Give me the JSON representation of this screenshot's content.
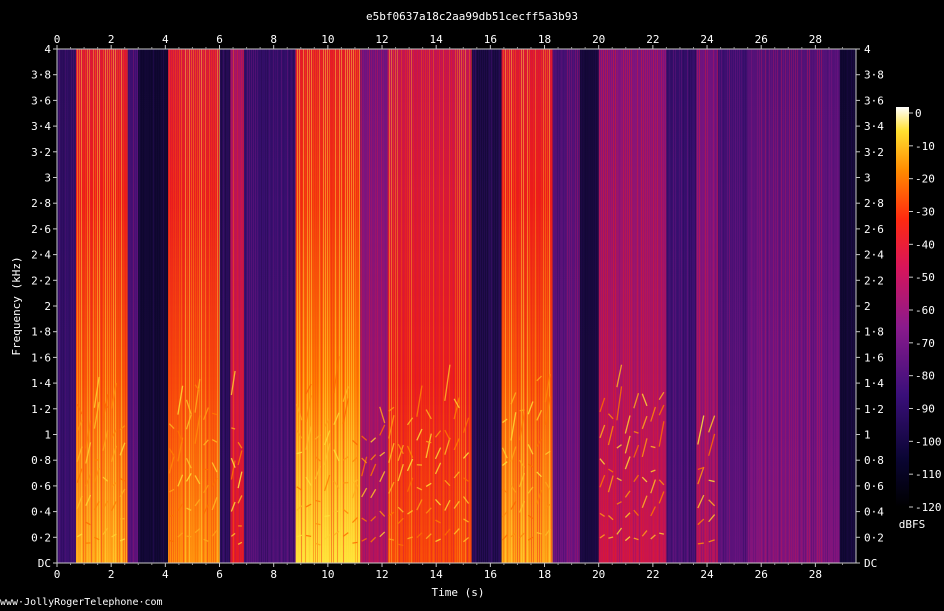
{
  "chart_data": {
    "type": "heatmap",
    "title": "e5bf0637a18c2aa99db51cecff5a3b93",
    "xlabel": "Time (s)",
    "ylabel": "Frequency (kHz)",
    "xlim": [
      0,
      29.5
    ],
    "ylim": [
      0,
      4
    ],
    "x_ticks": [
      "0",
      "2",
      "4",
      "6",
      "8",
      "10",
      "12",
      "14",
      "16",
      "18",
      "20",
      "22",
      "24",
      "26",
      "28"
    ],
    "y_ticks": [
      "DC",
      "0·2",
      "0·4",
      "0·6",
      "0·8",
      "1",
      "1·2",
      "1·4",
      "1·6",
      "1·8",
      "2",
      "2·2",
      "2·4",
      "2·6",
      "2·8",
      "3",
      "3·2",
      "3·4",
      "3·6",
      "3·8",
      "4"
    ],
    "colorbar": {
      "label": "dBFS",
      "range": [
        -120,
        0
      ],
      "ticks": [
        "0",
        "-10",
        "-20",
        "-30",
        "-40",
        "-50",
        "-60",
        "-70",
        "-80",
        "-90",
        "-100",
        "-110",
        "-120"
      ]
    },
    "energy_segments": [
      {
        "start": 0.0,
        "end": 0.7,
        "level": 0.25
      },
      {
        "start": 0.7,
        "end": 2.6,
        "level": 0.9
      },
      {
        "start": 2.6,
        "end": 3.0,
        "level": 0.35
      },
      {
        "start": 3.0,
        "end": 4.1,
        "level": 0.05
      },
      {
        "start": 4.1,
        "end": 6.0,
        "level": 0.88
      },
      {
        "start": 6.0,
        "end": 6.4,
        "level": 0.2
      },
      {
        "start": 6.4,
        "end": 6.9,
        "level": 0.7
      },
      {
        "start": 6.9,
        "end": 8.8,
        "level": 0.3
      },
      {
        "start": 8.8,
        "end": 11.2,
        "level": 0.95
      },
      {
        "start": 11.2,
        "end": 12.2,
        "level": 0.55
      },
      {
        "start": 12.2,
        "end": 15.3,
        "level": 0.8
      },
      {
        "start": 15.3,
        "end": 16.4,
        "level": 0.15
      },
      {
        "start": 16.4,
        "end": 18.3,
        "level": 0.9
      },
      {
        "start": 18.3,
        "end": 19.3,
        "level": 0.4
      },
      {
        "start": 19.3,
        "end": 20.0,
        "level": 0.08
      },
      {
        "start": 20.0,
        "end": 22.5,
        "level": 0.6
      },
      {
        "start": 22.5,
        "end": 23.6,
        "level": 0.3
      },
      {
        "start": 23.6,
        "end": 24.4,
        "level": 0.55
      },
      {
        "start": 24.4,
        "end": 25.5,
        "level": 0.35
      },
      {
        "start": 25.5,
        "end": 28.9,
        "level": 0.45
      },
      {
        "start": 28.9,
        "end": 29.5,
        "level": 0.05
      }
    ]
  },
  "footer": {
    "credit": "www·JollyRogerTelephone·com"
  }
}
